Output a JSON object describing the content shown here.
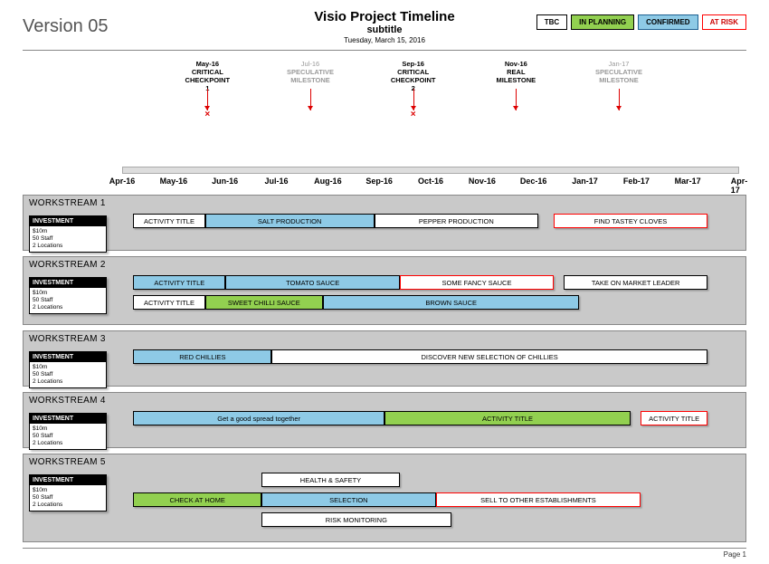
{
  "header": {
    "version": "Version 05",
    "title": "Visio Project Timeline",
    "subtitle": "subtitle",
    "date": "Tuesday, March 15, 2016"
  },
  "legend": {
    "tbc": "TBC",
    "planning": "IN PLANNING",
    "confirmed": "CONFIRMED",
    "risk": "AT RISK"
  },
  "axis": {
    "ticks": [
      "Apr-16",
      "May-16",
      "Jun-16",
      "Jul-16",
      "Aug-16",
      "Sep-16",
      "Oct-16",
      "Nov-16",
      "Dec-16",
      "Jan-17",
      "Feb-17",
      "Mar-17",
      "Apr-17"
    ]
  },
  "milestones": [
    {
      "date": "May-16",
      "line1": "CRITICAL",
      "line2": "CHECKPOINT",
      "sub": "1",
      "style": "critical",
      "pos": 1.66,
      "x": true
    },
    {
      "date": "Jul-16",
      "line1": "SPECULATIVE",
      "line2": "MILESTONE",
      "sub": "",
      "style": "speculative",
      "pos": 3.66,
      "x": false
    },
    {
      "date": "Sep-16",
      "line1": "CRITICAL",
      "line2": "CHECKPOINT",
      "sub": "2",
      "style": "critical",
      "pos": 5.66,
      "x": true
    },
    {
      "date": "Nov-16",
      "line1": "REAL",
      "line2": "MILESTONE",
      "sub": "",
      "style": "normal",
      "pos": 7.66,
      "x": false
    },
    {
      "date": "Jan-17",
      "line1": "SPECULATIVE",
      "line2": "MILESTONE",
      "sub": "",
      "style": "speculative",
      "pos": 9.66,
      "x": false
    }
  ],
  "investment": {
    "head": "INVESTMENT",
    "body": [
      "$10m",
      "50 Staff",
      "2 Locations"
    ]
  },
  "workstreams": [
    {
      "title": "WORKSTREAM 1",
      "rows": [
        [
          {
            "label": "ACTIVITY TITLE",
            "start": 0.2,
            "end": 1.6,
            "cls": "c-tbc"
          },
          {
            "label": "SALT PRODUCTION",
            "start": 1.6,
            "end": 4.9,
            "cls": "c-conf"
          },
          {
            "label": "PEPPER PRODUCTION",
            "start": 4.9,
            "end": 8.1,
            "cls": "c-tbc"
          },
          {
            "label": "FIND TASTEY CLOVES",
            "start": 8.4,
            "end": 11.4,
            "cls": "c-risk"
          }
        ]
      ]
    },
    {
      "title": "WORKSTREAM 2",
      "rows": [
        [
          {
            "label": "ACTIVITY TITLE",
            "start": 0.2,
            "end": 2.0,
            "cls": "c-conf"
          },
          {
            "label": "TOMATO SAUCE",
            "start": 2.0,
            "end": 5.4,
            "cls": "c-conf"
          },
          {
            "label": "SOME FANCY SAUCE",
            "start": 5.4,
            "end": 8.4,
            "cls": "c-risk"
          },
          {
            "label": "TAKE ON MARKET LEADER",
            "start": 8.6,
            "end": 11.4,
            "cls": "c-tbc"
          }
        ],
        [
          {
            "label": "ACTIVITY TITLE",
            "start": 0.2,
            "end": 1.6,
            "cls": "c-tbc"
          },
          {
            "label": "SWEET CHILLI SAUCE",
            "start": 1.6,
            "end": 3.9,
            "cls": "c-plan"
          },
          {
            "label": "BROWN SAUCE",
            "start": 3.9,
            "end": 8.9,
            "cls": "c-conf"
          }
        ]
      ]
    },
    {
      "title": "WORKSTREAM 3",
      "rows": [
        [
          {
            "label": "RED CHILLIES",
            "start": 0.2,
            "end": 2.9,
            "cls": "c-conf"
          },
          {
            "label": "DISCOVER NEW SELECTION OF CHILLIES",
            "start": 2.9,
            "end": 11.4,
            "cls": "c-tbc"
          }
        ]
      ]
    },
    {
      "title": "WORKSTREAM 4",
      "rows": [
        [
          {
            "label": "Get a good spread together",
            "start": 0.2,
            "end": 5.1,
            "cls": "c-conf"
          },
          {
            "label": "ACTIVITY TITLE",
            "start": 5.1,
            "end": 9.9,
            "cls": "c-plan"
          },
          {
            "label": "ACTIVITY TITLE",
            "start": 10.1,
            "end": 11.4,
            "cls": "c-risk"
          }
        ]
      ]
    },
    {
      "title": "WORKSTREAM 5",
      "rows": [
        [
          {
            "label": "HEALTH & SAFETY",
            "start": 2.7,
            "end": 5.4,
            "cls": "c-tbc"
          }
        ],
        [
          {
            "label": "CHECK AT HOME",
            "start": 0.2,
            "end": 2.7,
            "cls": "c-plan"
          },
          {
            "label": "SELECTION",
            "start": 2.7,
            "end": 6.1,
            "cls": "c-conf"
          },
          {
            "label": "SELL TO OTHER ESTABLISHMENTS",
            "start": 6.1,
            "end": 10.1,
            "cls": "c-risk"
          }
        ],
        [
          {
            "label": "RISK MONITORING",
            "start": 2.7,
            "end": 6.4,
            "cls": "c-tbc"
          }
        ]
      ]
    }
  ],
  "footer": {
    "page": "Page 1"
  },
  "chart_data": {
    "type": "table",
    "description": "Gantt-style project timeline across months Apr-16 to Apr-17 with milestone markers and five workstreams of activities classified TBC / In Planning / Confirmed / At Risk.",
    "time_range": {
      "start": "Apr-16",
      "end": "Apr-17",
      "tick_count": 13
    },
    "milestones": [
      {
        "name": "CRITICAL CHECKPOINT 1",
        "approx_month": "late May-16"
      },
      {
        "name": "SPECULATIVE MILESTONE",
        "approx_month": "late Jul-16"
      },
      {
        "name": "CRITICAL CHECKPOINT 2",
        "approx_month": "late Sep-16"
      },
      {
        "name": "REAL MILESTONE",
        "approx_month": "late Nov-16"
      },
      {
        "name": "SPECULATIVE MILESTONE",
        "approx_month": "late Jan-17"
      }
    ]
  }
}
